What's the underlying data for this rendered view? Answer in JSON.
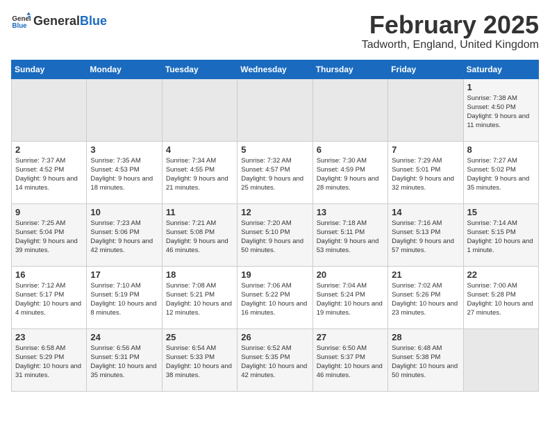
{
  "header": {
    "logo_general": "General",
    "logo_blue": "Blue",
    "title": "February 2025",
    "subtitle": "Tadworth, England, United Kingdom"
  },
  "calendar": {
    "days_of_week": [
      "Sunday",
      "Monday",
      "Tuesday",
      "Wednesday",
      "Thursday",
      "Friday",
      "Saturday"
    ],
    "weeks": [
      [
        {
          "day": "",
          "info": ""
        },
        {
          "day": "",
          "info": ""
        },
        {
          "day": "",
          "info": ""
        },
        {
          "day": "",
          "info": ""
        },
        {
          "day": "",
          "info": ""
        },
        {
          "day": "",
          "info": ""
        },
        {
          "day": "1",
          "info": "Sunrise: 7:38 AM\nSunset: 4:50 PM\nDaylight: 9 hours and 11 minutes."
        }
      ],
      [
        {
          "day": "2",
          "info": "Sunrise: 7:37 AM\nSunset: 4:52 PM\nDaylight: 9 hours and 14 minutes."
        },
        {
          "day": "3",
          "info": "Sunrise: 7:35 AM\nSunset: 4:53 PM\nDaylight: 9 hours and 18 minutes."
        },
        {
          "day": "4",
          "info": "Sunrise: 7:34 AM\nSunset: 4:55 PM\nDaylight: 9 hours and 21 minutes."
        },
        {
          "day": "5",
          "info": "Sunrise: 7:32 AM\nSunset: 4:57 PM\nDaylight: 9 hours and 25 minutes."
        },
        {
          "day": "6",
          "info": "Sunrise: 7:30 AM\nSunset: 4:59 PM\nDaylight: 9 hours and 28 minutes."
        },
        {
          "day": "7",
          "info": "Sunrise: 7:29 AM\nSunset: 5:01 PM\nDaylight: 9 hours and 32 minutes."
        },
        {
          "day": "8",
          "info": "Sunrise: 7:27 AM\nSunset: 5:02 PM\nDaylight: 9 hours and 35 minutes."
        }
      ],
      [
        {
          "day": "9",
          "info": "Sunrise: 7:25 AM\nSunset: 5:04 PM\nDaylight: 9 hours and 39 minutes."
        },
        {
          "day": "10",
          "info": "Sunrise: 7:23 AM\nSunset: 5:06 PM\nDaylight: 9 hours and 42 minutes."
        },
        {
          "day": "11",
          "info": "Sunrise: 7:21 AM\nSunset: 5:08 PM\nDaylight: 9 hours and 46 minutes."
        },
        {
          "day": "12",
          "info": "Sunrise: 7:20 AM\nSunset: 5:10 PM\nDaylight: 9 hours and 50 minutes."
        },
        {
          "day": "13",
          "info": "Sunrise: 7:18 AM\nSunset: 5:11 PM\nDaylight: 9 hours and 53 minutes."
        },
        {
          "day": "14",
          "info": "Sunrise: 7:16 AM\nSunset: 5:13 PM\nDaylight: 9 hours and 57 minutes."
        },
        {
          "day": "15",
          "info": "Sunrise: 7:14 AM\nSunset: 5:15 PM\nDaylight: 10 hours and 1 minute."
        }
      ],
      [
        {
          "day": "16",
          "info": "Sunrise: 7:12 AM\nSunset: 5:17 PM\nDaylight: 10 hours and 4 minutes."
        },
        {
          "day": "17",
          "info": "Sunrise: 7:10 AM\nSunset: 5:19 PM\nDaylight: 10 hours and 8 minutes."
        },
        {
          "day": "18",
          "info": "Sunrise: 7:08 AM\nSunset: 5:21 PM\nDaylight: 10 hours and 12 minutes."
        },
        {
          "day": "19",
          "info": "Sunrise: 7:06 AM\nSunset: 5:22 PM\nDaylight: 10 hours and 16 minutes."
        },
        {
          "day": "20",
          "info": "Sunrise: 7:04 AM\nSunset: 5:24 PM\nDaylight: 10 hours and 19 minutes."
        },
        {
          "day": "21",
          "info": "Sunrise: 7:02 AM\nSunset: 5:26 PM\nDaylight: 10 hours and 23 minutes."
        },
        {
          "day": "22",
          "info": "Sunrise: 7:00 AM\nSunset: 5:28 PM\nDaylight: 10 hours and 27 minutes."
        }
      ],
      [
        {
          "day": "23",
          "info": "Sunrise: 6:58 AM\nSunset: 5:29 PM\nDaylight: 10 hours and 31 minutes."
        },
        {
          "day": "24",
          "info": "Sunrise: 6:56 AM\nSunset: 5:31 PM\nDaylight: 10 hours and 35 minutes."
        },
        {
          "day": "25",
          "info": "Sunrise: 6:54 AM\nSunset: 5:33 PM\nDaylight: 10 hours and 38 minutes."
        },
        {
          "day": "26",
          "info": "Sunrise: 6:52 AM\nSunset: 5:35 PM\nDaylight: 10 hours and 42 minutes."
        },
        {
          "day": "27",
          "info": "Sunrise: 6:50 AM\nSunset: 5:37 PM\nDaylight: 10 hours and 46 minutes."
        },
        {
          "day": "28",
          "info": "Sunrise: 6:48 AM\nSunset: 5:38 PM\nDaylight: 10 hours and 50 minutes."
        },
        {
          "day": "",
          "info": ""
        }
      ]
    ]
  }
}
